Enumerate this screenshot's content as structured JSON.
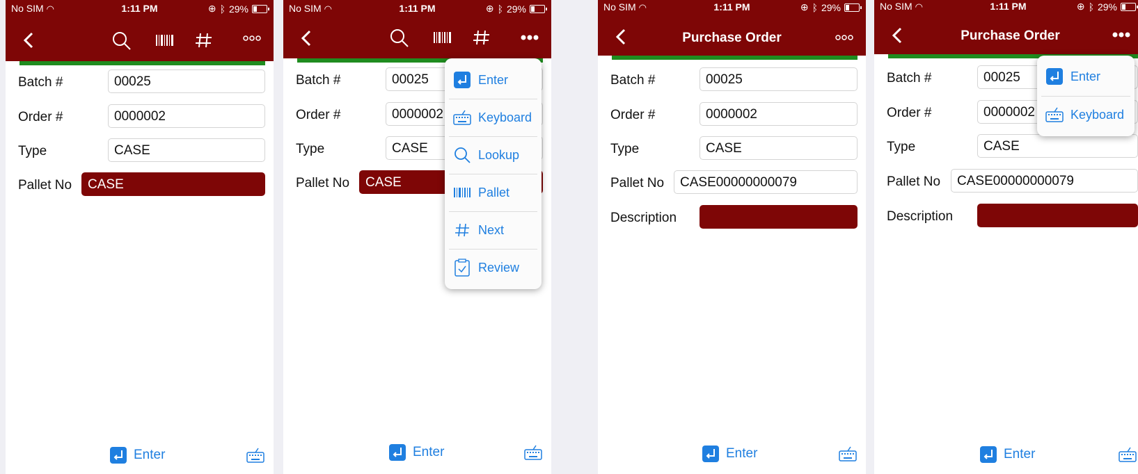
{
  "status": {
    "carrier": "No SIM",
    "time": "1:11 PM",
    "battery": "29%"
  },
  "nav": {
    "title": "Purchase Order"
  },
  "labels": {
    "batch": "Batch #",
    "order": "Order #",
    "type": "Type",
    "pallet": "Pallet No",
    "description": "Description"
  },
  "values": {
    "batch": "00025",
    "order": "0000002",
    "type": "CASE",
    "pallet_partial": "CASE",
    "pallet_full": "CASE00000000079",
    "order_truncated": "0000002"
  },
  "bottom": {
    "enter_label": "Enter"
  },
  "menu_full": [
    {
      "label": "Enter",
      "icon": "enter-icon"
    },
    {
      "label": "Keyboard",
      "icon": "keyboard-icon"
    },
    {
      "label": "Lookup",
      "icon": "search-icon"
    },
    {
      "label": "Pallet",
      "icon": "barcode-icon"
    },
    {
      "label": "Next",
      "icon": "hash-icon"
    },
    {
      "label": "Review",
      "icon": "clipboard-icon"
    }
  ],
  "menu_short": [
    {
      "label": "Enter",
      "icon": "enter-icon"
    },
    {
      "label": "Keyboard",
      "icon": "keyboard-icon"
    }
  ],
  "colors": {
    "brand": "#7e0606",
    "accent": "#1f7fe0",
    "green": "#1f8c1f"
  }
}
